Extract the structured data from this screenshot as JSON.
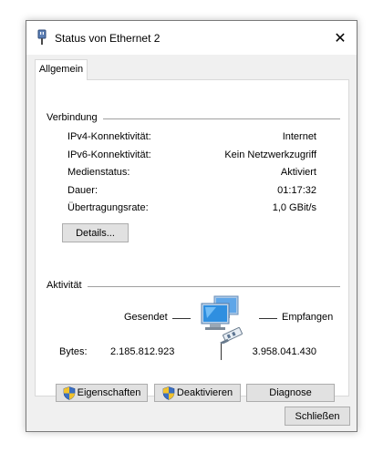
{
  "window": {
    "title": "Status von Ethernet 2",
    "close_glyph": "✕",
    "tab_label": "Allgemein"
  },
  "connection": {
    "group_label": "Verbindung",
    "rows": [
      {
        "label": "IPv4-Konnektivität:",
        "value": "Internet"
      },
      {
        "label": "IPv6-Konnektivität:",
        "value": "Kein Netzwerkzugriff"
      },
      {
        "label": "Medienstatus:",
        "value": "Aktiviert"
      },
      {
        "label": "Dauer:",
        "value": "01:17:32"
      },
      {
        "label": "Übertragungsrate:",
        "value": "1,0 GBit/s"
      }
    ],
    "details_button": "Details..."
  },
  "activity": {
    "group_label": "Aktivität",
    "sent_label": "Gesendet",
    "received_label": "Empfangen",
    "bytes_label": "Bytes:",
    "bytes_sent": "2.185.812.923",
    "bytes_received": "3.958.041.430",
    "icon": "network-computers-icon"
  },
  "buttons": {
    "properties": "Eigenschaften",
    "deactivate": "Deaktivieren",
    "diagnose": "Diagnose",
    "close": "Schließen"
  },
  "colors": {
    "window_bg": "#f0f0f0",
    "button_bg": "#e1e1e1",
    "monitor_blue": "#2f8fe0",
    "shield_blue": "#3a6fc4",
    "shield_yellow": "#f2c22c"
  }
}
